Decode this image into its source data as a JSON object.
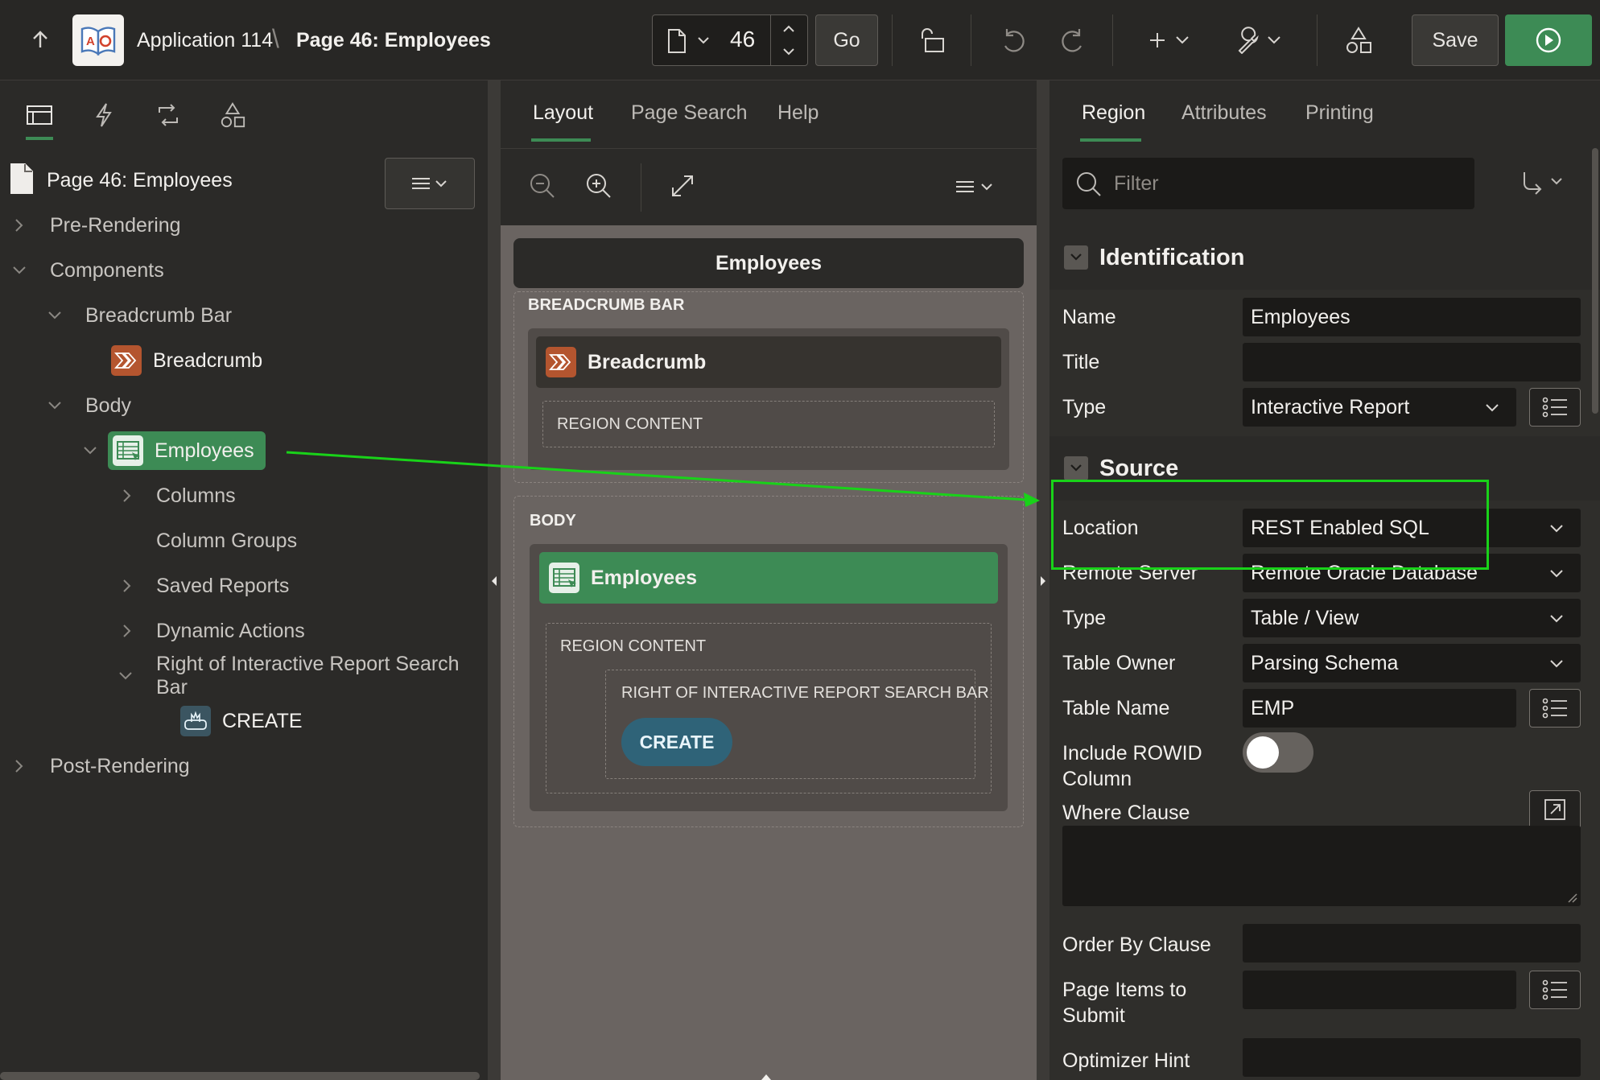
{
  "header": {
    "app_name": "Application 114",
    "separator": "\\",
    "page_name": "Page 46: Employees",
    "page_number": "46",
    "go_label": "Go",
    "save_label": "Save"
  },
  "tree": {
    "page_title": "Page 46: Employees",
    "pre_rendering": "Pre-Rendering",
    "components": "Components",
    "breadcrumb_bar": "Breadcrumb Bar",
    "breadcrumb": "Breadcrumb",
    "body": "Body",
    "employees": "Employees",
    "columns": "Columns",
    "column_groups": "Column Groups",
    "saved_reports": "Saved Reports",
    "dynamic_actions": "Dynamic Actions",
    "right_of_ir": "Right of Interactive Report Search Bar",
    "create": "CREATE",
    "post_rendering": "Post-Rendering"
  },
  "middle": {
    "tabs": [
      "Layout",
      "Page Search",
      "Help"
    ],
    "layout_title": "Employees",
    "breadcrumb_bar_caption": "BREADCRUMB BAR",
    "breadcrumb_label": "Breadcrumb",
    "region_content": "REGION CONTENT",
    "body_caption": "BODY",
    "employees_label": "Employees",
    "right_of_ir_caption": "RIGHT OF INTERACTIVE REPORT SEARCH BAR",
    "create_label": "CREATE"
  },
  "right": {
    "tabs": [
      "Region",
      "Attributes",
      "Printing"
    ],
    "filter_placeholder": "Filter",
    "identification": {
      "heading": "Identification",
      "name_label": "Name",
      "name_value": "Employees",
      "title_label": "Title",
      "title_value": "",
      "type_label": "Type",
      "type_value": "Interactive Report"
    },
    "source": {
      "heading": "Source",
      "location_label": "Location",
      "location_value": "REST Enabled SQL",
      "remote_server_label": "Remote Server",
      "remote_server_value": "Remote Oracle Database",
      "type_label": "Type",
      "type_value": "Table / View",
      "table_owner_label": "Table Owner",
      "table_owner_value": "Parsing Schema",
      "table_name_label": "Table Name",
      "table_name_value": "EMP",
      "include_rowid_label_1": "Include ROWID",
      "include_rowid_label_2": "Column",
      "include_rowid_on": false,
      "where_label": "Where Clause",
      "order_by_label": "Order By Clause",
      "page_items_label_1": "Page Items to",
      "page_items_label_2": "Submit",
      "optimizer_label": "Optimizer Hint"
    }
  },
  "colors": {
    "accent_green": "#3d8b55",
    "highlight_green": "#19d219",
    "breadcrumb_orange": "#b4552f",
    "create_blue": "#2f6378"
  }
}
